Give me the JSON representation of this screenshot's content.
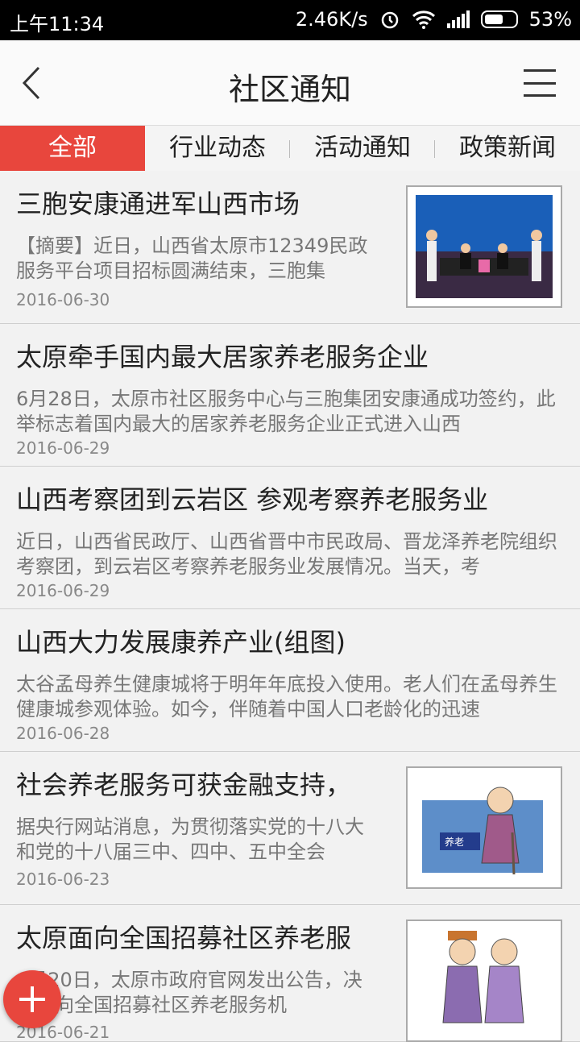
{
  "status": {
    "time": "上午11:34",
    "speed": "2.46K/s",
    "battery": "53%"
  },
  "header": {
    "title": "社区通知"
  },
  "tabs": [
    {
      "label": "全部",
      "active": true
    },
    {
      "label": "行业动态"
    },
    {
      "label": "活动通知"
    },
    {
      "label": "政策新闻"
    }
  ],
  "articles": [
    {
      "title": "三胞安康通进军山西市场",
      "summary": "【摘要】近日，山西省太原市12349民政服务平台项目招标圆满结束，三胞集",
      "date": "2016-06-30",
      "thumb": "signing-ceremony-photo"
    },
    {
      "title": "太原牵手国内最大居家养老服务企业",
      "summary": "6月28日，太原市社区服务中心与三胞集团安康通成功签约，此举标志着国内最大的居家养老服务企业正式进入山西",
      "date": "2016-06-29"
    },
    {
      "title": "山西考察团到云岩区 参观考察养老服务业",
      "summary": "近日，山西省民政厅、山西省晋中市民政局、晋龙泽养老院组织考察团，到云岩区考察养老服务业发展情况。当天，考",
      "date": "2016-06-29"
    },
    {
      "title": "山西大力发展康养产业(组图)",
      "summary": "太谷孟母养生健康城将于明年年底投入使用。老人们在孟母养生健康城参观体验。如今，伴随着中国人口老龄化的迅速",
      "date": "2016-06-28"
    },
    {
      "title": "社会养老服务可获金融支持，",
      "summary": "据央行网站消息，为贯彻落实党的十八大和党的十八届三中、四中、五中全会",
      "date": "2016-06-23",
      "thumb": "elderly-cartoon",
      "thumb_text": "养老"
    },
    {
      "title": "太原面向全国招募社区养老服",
      "summary": "6月20日，太原市政府官网发出公告，决定面向全国招募社区养老服务机",
      "date": "2016-06-21",
      "thumb": "elderly-couple-cartoon"
    }
  ],
  "fab": {
    "icon": "plus-icon"
  }
}
